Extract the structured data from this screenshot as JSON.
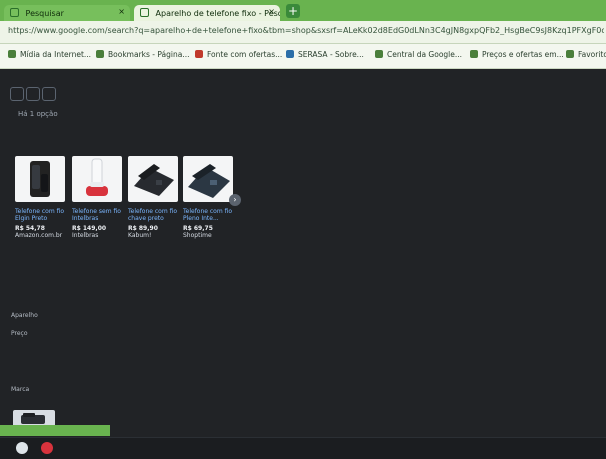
{
  "browser": {
    "tabs": [
      {
        "label": "Pesquisar",
        "state": "inactive"
      },
      {
        "label": "Aparelho de telefone fixo - Pesq...",
        "state": "active"
      }
    ],
    "new_tab_label": "+",
    "tab_close_label": "×",
    "address": "https://www.google.com/search?q=aparelho+de+telefone+fixo&tbm=shop&sxsrf=ALeKk02d8EdG0dLNn3C4gJN8gxpQFb2_HsgBeC9sJ8Kzq1PFXgF0o9nXvYk2tXw2KX4QO4bDLmI0qXm8sA",
    "bookmarks": [
      "Mídia da Internet...",
      "Bookmarks - Página...",
      "Fonte com ofertas...",
      "SERASA - Sobre...",
      "Central da Google...",
      "Preços e ofertas em...",
      "Favoritos"
    ],
    "bookmark_icon_colors": [
      "#4a7f3b",
      "#4a7f3b",
      "#c0392b",
      "#2b6ea8",
      "#4a7f3b",
      "#4a7f3b",
      "#4a7f3b"
    ]
  },
  "page": {
    "section_label": "Há 1 opção",
    "products": [
      {
        "title": "Telefone com fio Elgin Preto",
        "price": "R$ 54,78",
        "seller": "Amazon.com.br",
        "image": "black-desk-phone"
      },
      {
        "title": "Telefone sem fio Intelbras",
        "price": "R$ 149,00",
        "seller": "Intelbras",
        "image": "white-red-cordless-phone"
      },
      {
        "title": "Telefone com fio chave preto",
        "price": "R$ 89,90",
        "seller": "Kabum!",
        "image": "dark-desk-phone-1"
      },
      {
        "title": "Telefone com fio Pleno Inte...",
        "price": "R$ 69,75",
        "seller": "Shoptime",
        "image": "dark-desk-phone-2"
      }
    ],
    "next_label": "›",
    "side_labels": [
      "Aparelho",
      "Preço",
      "Marca"
    ]
  },
  "taskbar": {
    "icons": [
      "app-icon",
      "close-icon"
    ]
  }
}
